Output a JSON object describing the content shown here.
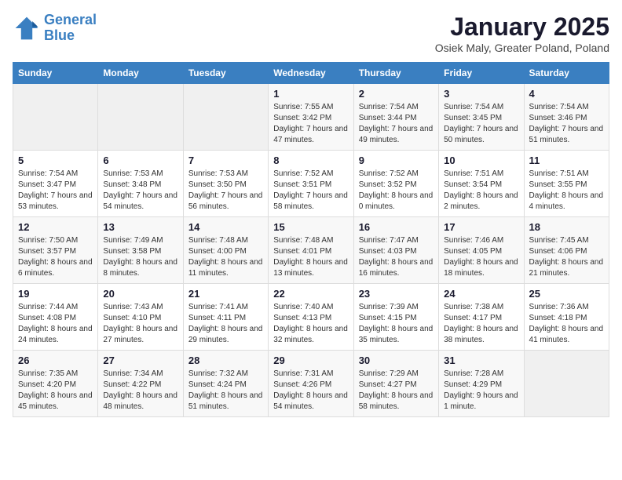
{
  "logo": {
    "line1": "General",
    "line2": "Blue"
  },
  "title": "January 2025",
  "subtitle": "Osiek Maly, Greater Poland, Poland",
  "days_of_week": [
    "Sunday",
    "Monday",
    "Tuesday",
    "Wednesday",
    "Thursday",
    "Friday",
    "Saturday"
  ],
  "weeks": [
    [
      {
        "day": "",
        "info": ""
      },
      {
        "day": "",
        "info": ""
      },
      {
        "day": "",
        "info": ""
      },
      {
        "day": "1",
        "info": "Sunrise: 7:55 AM\nSunset: 3:42 PM\nDaylight: 7 hours and 47 minutes."
      },
      {
        "day": "2",
        "info": "Sunrise: 7:54 AM\nSunset: 3:44 PM\nDaylight: 7 hours and 49 minutes."
      },
      {
        "day": "3",
        "info": "Sunrise: 7:54 AM\nSunset: 3:45 PM\nDaylight: 7 hours and 50 minutes."
      },
      {
        "day": "4",
        "info": "Sunrise: 7:54 AM\nSunset: 3:46 PM\nDaylight: 7 hours and 51 minutes."
      }
    ],
    [
      {
        "day": "5",
        "info": "Sunrise: 7:54 AM\nSunset: 3:47 PM\nDaylight: 7 hours and 53 minutes."
      },
      {
        "day": "6",
        "info": "Sunrise: 7:53 AM\nSunset: 3:48 PM\nDaylight: 7 hours and 54 minutes."
      },
      {
        "day": "7",
        "info": "Sunrise: 7:53 AM\nSunset: 3:50 PM\nDaylight: 7 hours and 56 minutes."
      },
      {
        "day": "8",
        "info": "Sunrise: 7:52 AM\nSunset: 3:51 PM\nDaylight: 7 hours and 58 minutes."
      },
      {
        "day": "9",
        "info": "Sunrise: 7:52 AM\nSunset: 3:52 PM\nDaylight: 8 hours and 0 minutes."
      },
      {
        "day": "10",
        "info": "Sunrise: 7:51 AM\nSunset: 3:54 PM\nDaylight: 8 hours and 2 minutes."
      },
      {
        "day": "11",
        "info": "Sunrise: 7:51 AM\nSunset: 3:55 PM\nDaylight: 8 hours and 4 minutes."
      }
    ],
    [
      {
        "day": "12",
        "info": "Sunrise: 7:50 AM\nSunset: 3:57 PM\nDaylight: 8 hours and 6 minutes."
      },
      {
        "day": "13",
        "info": "Sunrise: 7:49 AM\nSunset: 3:58 PM\nDaylight: 8 hours and 8 minutes."
      },
      {
        "day": "14",
        "info": "Sunrise: 7:48 AM\nSunset: 4:00 PM\nDaylight: 8 hours and 11 minutes."
      },
      {
        "day": "15",
        "info": "Sunrise: 7:48 AM\nSunset: 4:01 PM\nDaylight: 8 hours and 13 minutes."
      },
      {
        "day": "16",
        "info": "Sunrise: 7:47 AM\nSunset: 4:03 PM\nDaylight: 8 hours and 16 minutes."
      },
      {
        "day": "17",
        "info": "Sunrise: 7:46 AM\nSunset: 4:05 PM\nDaylight: 8 hours and 18 minutes."
      },
      {
        "day": "18",
        "info": "Sunrise: 7:45 AM\nSunset: 4:06 PM\nDaylight: 8 hours and 21 minutes."
      }
    ],
    [
      {
        "day": "19",
        "info": "Sunrise: 7:44 AM\nSunset: 4:08 PM\nDaylight: 8 hours and 24 minutes."
      },
      {
        "day": "20",
        "info": "Sunrise: 7:43 AM\nSunset: 4:10 PM\nDaylight: 8 hours and 27 minutes."
      },
      {
        "day": "21",
        "info": "Sunrise: 7:41 AM\nSunset: 4:11 PM\nDaylight: 8 hours and 29 minutes."
      },
      {
        "day": "22",
        "info": "Sunrise: 7:40 AM\nSunset: 4:13 PM\nDaylight: 8 hours and 32 minutes."
      },
      {
        "day": "23",
        "info": "Sunrise: 7:39 AM\nSunset: 4:15 PM\nDaylight: 8 hours and 35 minutes."
      },
      {
        "day": "24",
        "info": "Sunrise: 7:38 AM\nSunset: 4:17 PM\nDaylight: 8 hours and 38 minutes."
      },
      {
        "day": "25",
        "info": "Sunrise: 7:36 AM\nSunset: 4:18 PM\nDaylight: 8 hours and 41 minutes."
      }
    ],
    [
      {
        "day": "26",
        "info": "Sunrise: 7:35 AM\nSunset: 4:20 PM\nDaylight: 8 hours and 45 minutes."
      },
      {
        "day": "27",
        "info": "Sunrise: 7:34 AM\nSunset: 4:22 PM\nDaylight: 8 hours and 48 minutes."
      },
      {
        "day": "28",
        "info": "Sunrise: 7:32 AM\nSunset: 4:24 PM\nDaylight: 8 hours and 51 minutes."
      },
      {
        "day": "29",
        "info": "Sunrise: 7:31 AM\nSunset: 4:26 PM\nDaylight: 8 hours and 54 minutes."
      },
      {
        "day": "30",
        "info": "Sunrise: 7:29 AM\nSunset: 4:27 PM\nDaylight: 8 hours and 58 minutes."
      },
      {
        "day": "31",
        "info": "Sunrise: 7:28 AM\nSunset: 4:29 PM\nDaylight: 9 hours and 1 minute."
      },
      {
        "day": "",
        "info": ""
      }
    ]
  ]
}
